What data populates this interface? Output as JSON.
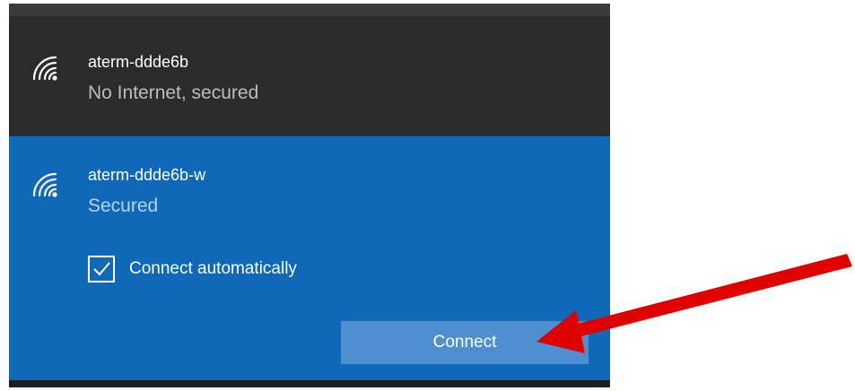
{
  "networks": [
    {
      "ssid": "aterm-ddde6b",
      "status": "No Internet, secured",
      "icon": "wifi-signal-icon",
      "selected": false
    },
    {
      "ssid": "aterm-ddde6b-w",
      "status": "Secured",
      "icon": "wifi-signal-icon",
      "selected": true,
      "connect_automatically_label": "Connect automatically",
      "connect_automatically_checked": true,
      "connect_button_label": "Connect"
    }
  ],
  "colors": {
    "inactive_bg": "#2b2b2b",
    "selected_bg": "#1068b8",
    "button_bg": "#4f8fcf",
    "annotation_arrow": "#e00000"
  }
}
